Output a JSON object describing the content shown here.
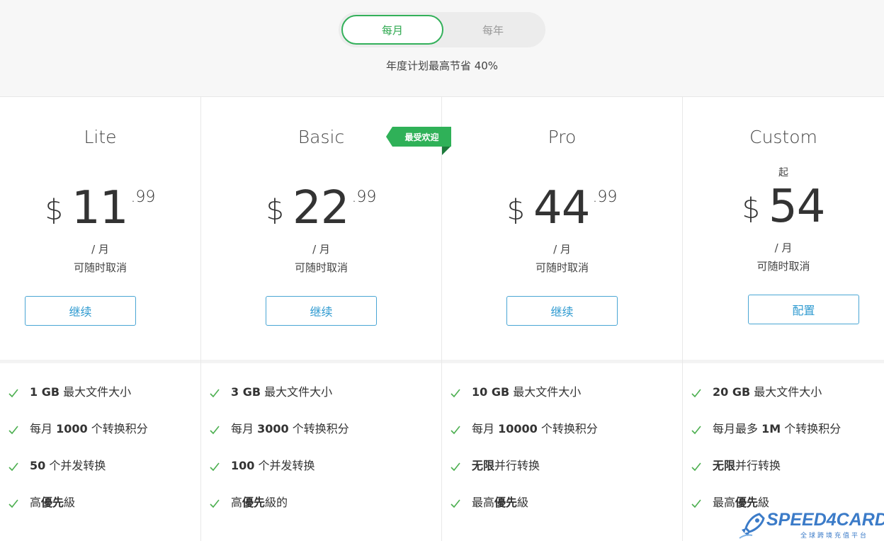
{
  "billing_toggle": {
    "monthly_label": "每月",
    "yearly_label": "每年",
    "selected": "monthly"
  },
  "savings_note": "年度计划最高节省 40%",
  "popular_badge": "最受欢迎",
  "plans": [
    {
      "name": "Lite",
      "from_label": "",
      "currency": "$",
      "amount": "11",
      "cents": ".99",
      "per": "/ 月",
      "cancel_note": "可随时取消",
      "cta": "继续",
      "features": [
        {
          "bold": "1 GB",
          "text": " 最大文件大小"
        },
        {
          "pre": "每月 ",
          "bold": "1000",
          "text": " 个转换积分"
        },
        {
          "bold": "50",
          "text": " 个并发转换"
        },
        {
          "pre": "高",
          "bold": "優先",
          "text": "級"
        }
      ]
    },
    {
      "name": "Basic",
      "from_label": "",
      "currency": "$",
      "amount": "22",
      "cents": ".99",
      "per": "/ 月",
      "cancel_note": "可随时取消",
      "cta": "继续",
      "features": [
        {
          "bold": "3 GB",
          "text": " 最大文件大小"
        },
        {
          "pre": "每月 ",
          "bold": "3000",
          "text": " 个转换积分"
        },
        {
          "bold": "100",
          "text": " 个并发转换"
        },
        {
          "pre": "高",
          "bold": "優先",
          "text": "級的"
        }
      ]
    },
    {
      "name": "Pro",
      "from_label": "",
      "currency": "$",
      "amount": "44",
      "cents": ".99",
      "per": "/ 月",
      "cancel_note": "可随时取消",
      "cta": "继续",
      "features": [
        {
          "bold": "10 GB",
          "text": " 最大文件大小"
        },
        {
          "pre": "每月 ",
          "bold": "10000",
          "text": " 个转换积分"
        },
        {
          "bold": "无限",
          "text": "并行转换"
        },
        {
          "pre": "最高",
          "bold": "優先",
          "text": "級"
        }
      ]
    },
    {
      "name": "Custom",
      "from_label": "起",
      "currency": "$",
      "amount": "54",
      "cents": "",
      "per": "/ 月",
      "cancel_note": "可随时取消",
      "cta": "配置",
      "features": [
        {
          "bold": "20 GB",
          "text": " 最大文件大小"
        },
        {
          "pre": "每月最多 ",
          "bold": "1M",
          "text": " 个转换积分"
        },
        {
          "bold": "无限",
          "text": "并行转换"
        },
        {
          "pre": "最高",
          "bold": "優先",
          "text": "級"
        }
      ]
    }
  ],
  "watermark": {
    "brand": "SPEED4CARD",
    "tagline": "全球跨境充值平台"
  },
  "colors": {
    "accent_green": "#2fb158",
    "button_blue": "#2e9ad0",
    "check_green": "#4caf50"
  }
}
